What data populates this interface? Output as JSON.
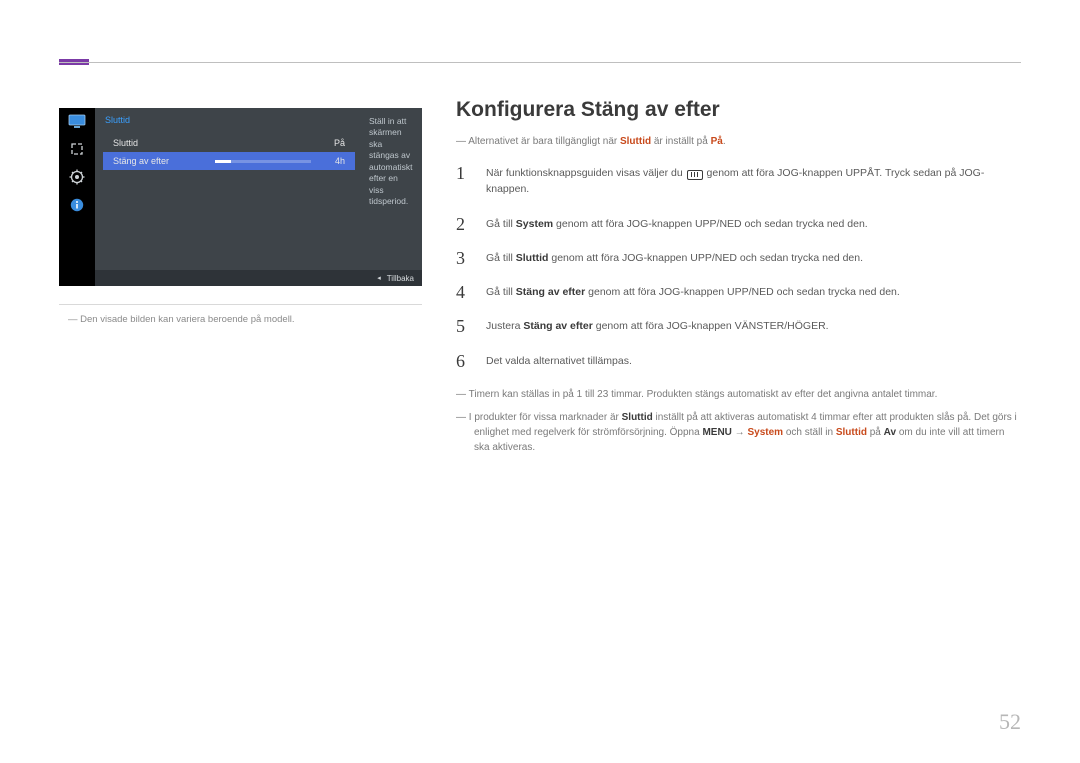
{
  "page_number": "52",
  "osd": {
    "title": "Sluttid",
    "row1_label": "Sluttid",
    "row1_value": "På",
    "row2_label": "Stäng av efter",
    "row2_value": "4h",
    "desc": "Ställ in att skärmen ska stängas av automatiskt efter en viss tidsperiod.",
    "back": "Tillbaka"
  },
  "caption": "Den visade bilden kan variera beroende på modell.",
  "heading": "Konfigurera Stäng av efter",
  "note_top_pre": "Alternativet är bara tillgängligt när ",
  "note_top_kw": "Sluttid",
  "note_top_mid": " är inställt på ",
  "note_top_kw2": "På",
  "note_top_post": ".",
  "steps": {
    "s1a": "När funktionsknappsguiden visas väljer du ",
    "s1b": " genom att föra JOG-knappen UPPÅT. Tryck sedan på JOG-knappen.",
    "s2a": "Gå till ",
    "s2kw": "System",
    "s2b": " genom att föra JOG-knappen UPP/NED och sedan trycka ned den.",
    "s3a": "Gå till ",
    "s3kw": "Sluttid",
    "s3b": " genom att föra JOG-knappen UPP/NED och sedan trycka ned den.",
    "s4a": "Gå till ",
    "s4kw": "Stäng av efter",
    "s4b": " genom att föra JOG-knappen UPP/NED och sedan trycka ned den.",
    "s5a": "Justera ",
    "s5kw": "Stäng av efter",
    "s5b": " genom att föra JOG-knappen VÄNSTER/HÖGER.",
    "s6": "Det valda alternativet tillämpas."
  },
  "note_mid": "Timern kan ställas in på 1 till 23 timmar. Produkten stängs automatiskt av efter det angivna antalet timmar.",
  "note_bot_a": "I produkter för vissa marknader är ",
  "note_bot_kw1": "Sluttid",
  "note_bot_b": " inställt på att aktiveras automatiskt 4 timmar efter att produkten slås på. Det görs i enlighet med regelverk för strömförsörjning. Öppna ",
  "note_bot_kw2": "MENU",
  "note_bot_arrow": " → ",
  "note_bot_kw3": "System",
  "note_bot_c": " och ställ in ",
  "note_bot_kw4": "Sluttid",
  "note_bot_d": " på ",
  "note_bot_kw5": "Av",
  "note_bot_e": " om du inte vill att timern ska aktiveras."
}
